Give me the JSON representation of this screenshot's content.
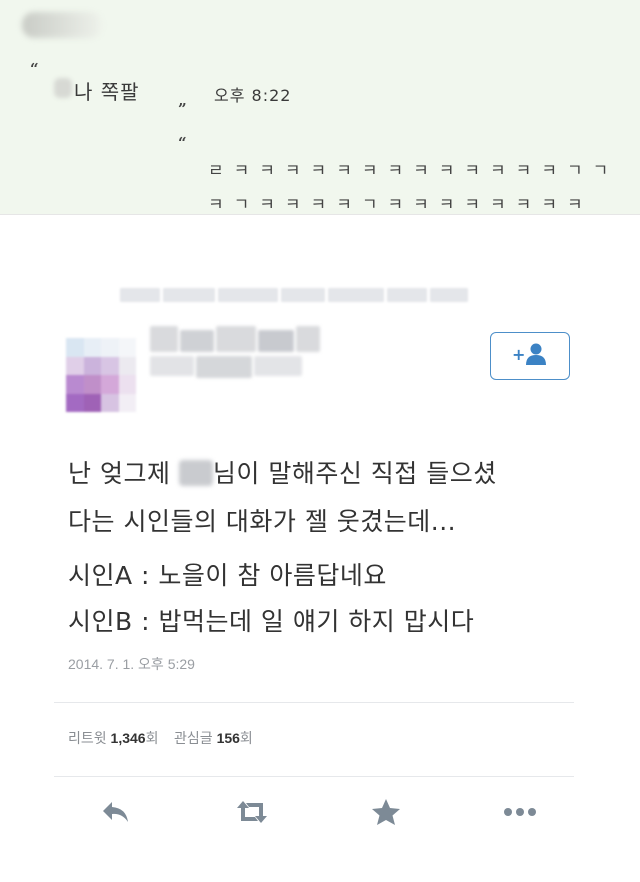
{
  "note": {
    "line1": "나 쪽팔",
    "time": "오후 8:22",
    "open_quote": "“",
    "close_quote": "”",
    "row1": "ㄹㅋㅋㅋㅋㅋㅋㅋㅋㅋㅋㅋㅋㅋㄱㄱ",
    "row2": "ㅋㄱㅋㅋㅋㅋㄱㅋㅋㅋㅋㅋㅋㅋㅋ"
  },
  "tweet": {
    "line1_a": "난 엊그제 ",
    "line1_b": "님이 말해주신 직접 들으셨",
    "line2": "다는 시인들의 대화가 젤 웃겼는데...",
    "line3": "시인A : 노을이 참 아름답네요",
    "line4": "시인B : 밥먹는데 일 얘기 하지 맙시다",
    "timestamp": "2014. 7. 1. 오후 5:29",
    "retweet_label": "리트윗",
    "retweet_count": "1,346",
    "retweet_unit": "회",
    "fav_label": "관심글",
    "fav_count": "156",
    "fav_unit": "회"
  },
  "colors": {
    "accent": "#3b82c4",
    "icon_gray": "#7d8a96",
    "note_bg": "#f1f7ee"
  },
  "icons": {
    "follow": "add-user-icon",
    "reply": "reply-icon",
    "retweet": "retweet-icon",
    "favorite": "star-icon",
    "more": "more-icon"
  }
}
